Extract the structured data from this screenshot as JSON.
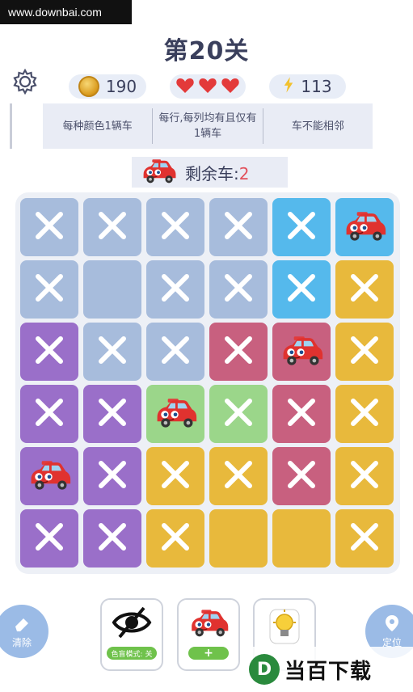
{
  "watermark": "www.downbai.com",
  "level": {
    "title": "第20关"
  },
  "stats": {
    "coins": "190",
    "hearts": 3,
    "energy": "113"
  },
  "rules": [
    "每种颜色1辆车",
    "每行,每列均有且仅有1辆车",
    "车不能相邻"
  ],
  "remaining": {
    "label": "剩余车:",
    "count": "2"
  },
  "colors": {
    "blue": "#a7bcdc",
    "cyan": "#55b9ec",
    "yellow": "#e8b93c",
    "purple": "#9a6fc9",
    "pink": "#c8607f",
    "green": "#9bd68a"
  },
  "board": [
    [
      {
        "c": "blue",
        "s": "x"
      },
      {
        "c": "blue",
        "s": "x"
      },
      {
        "c": "blue",
        "s": "x"
      },
      {
        "c": "blue",
        "s": "x"
      },
      {
        "c": "cyan",
        "s": "x"
      },
      {
        "c": "cyan",
        "s": "car"
      }
    ],
    [
      {
        "c": "blue",
        "s": "x"
      },
      {
        "c": "blue",
        "s": "empty"
      },
      {
        "c": "blue",
        "s": "x"
      },
      {
        "c": "blue",
        "s": "x"
      },
      {
        "c": "cyan",
        "s": "x"
      },
      {
        "c": "yellow",
        "s": "x"
      }
    ],
    [
      {
        "c": "purple",
        "s": "x"
      },
      {
        "c": "blue",
        "s": "x"
      },
      {
        "c": "blue",
        "s": "x"
      },
      {
        "c": "pink",
        "s": "x"
      },
      {
        "c": "pink",
        "s": "car"
      },
      {
        "c": "yellow",
        "s": "x"
      }
    ],
    [
      {
        "c": "purple",
        "s": "x"
      },
      {
        "c": "purple",
        "s": "x"
      },
      {
        "c": "green",
        "s": "car"
      },
      {
        "c": "green",
        "s": "x"
      },
      {
        "c": "pink",
        "s": "x"
      },
      {
        "c": "yellow",
        "s": "x"
      }
    ],
    [
      {
        "c": "purple",
        "s": "car"
      },
      {
        "c": "purple",
        "s": "x"
      },
      {
        "c": "yellow",
        "s": "x"
      },
      {
        "c": "yellow",
        "s": "x"
      },
      {
        "c": "pink",
        "s": "x"
      },
      {
        "c": "yellow",
        "s": "x"
      }
    ],
    [
      {
        "c": "purple",
        "s": "x"
      },
      {
        "c": "purple",
        "s": "x"
      },
      {
        "c": "yellow",
        "s": "x"
      },
      {
        "c": "yellow",
        "s": "empty"
      },
      {
        "c": "yellow",
        "s": "empty"
      },
      {
        "c": "yellow",
        "s": "x"
      }
    ]
  ],
  "bottom": {
    "clear_label": "清除",
    "locate_label": "定位",
    "eye_tag": "色盲模式: 关",
    "add_plus": "+",
    "brand_logo": "D",
    "brand_text": "当百下载"
  }
}
